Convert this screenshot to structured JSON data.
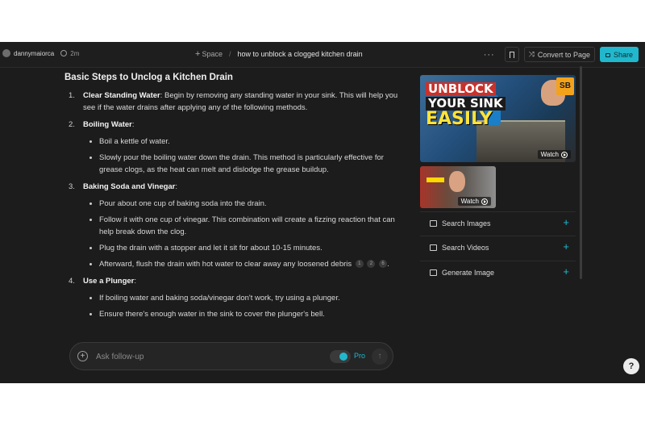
{
  "topbar": {
    "username": "dannymaiorca",
    "time_ago": "2m",
    "space_label": "Space",
    "thread_title": "how to unblock a clogged kitchen drain",
    "more_icon": "more-horizontal-icon",
    "bookmark_icon": "bookmark-icon",
    "convert_label": "Convert to Page",
    "share_label": "Share",
    "accent_color": "#21b8cd"
  },
  "answer": {
    "heading": "Basic Steps to Unclog a Kitchen Drain",
    "steps": [
      {
        "num": "1.",
        "title": "Clear Standing Water",
        "text": ": Begin by removing any standing water in your sink. This will help you see if the water drains after applying any of the following methods.",
        "bullets": []
      },
      {
        "num": "2.",
        "title": "Boiling Water",
        "text": ":",
        "bullets": [
          "Boil a kettle of water.",
          "Slowly pour the boiling water down the drain. This method is particularly effective for grease clogs, as the heat can melt and dislodge the grease buildup."
        ]
      },
      {
        "num": "3.",
        "title": "Baking Soda and Vinegar",
        "text": ":",
        "bullets": [
          "Pour about one cup of baking soda into the drain.",
          "Follow it with one cup of vinegar. This combination will create a fizzing reaction that can help break down the clog.",
          "Plug the drain with a stopper and let it sit for about 10-15 minutes.",
          "Afterward, flush the drain with hot water to clear away any loosened debris"
        ],
        "citations": [
          "1",
          "2",
          "6"
        ]
      },
      {
        "num": "4.",
        "title": "Use a Plunger",
        "text": ":",
        "bullets": [
          "If boiling water and baking soda/vinegar don't work, try using a plunger.",
          "Ensure there's enough water in the sink to cover the plunger's bell."
        ]
      }
    ]
  },
  "followup": {
    "placeholder": "Ask follow-up",
    "pro_label": "Pro",
    "pro_enabled": true
  },
  "sidebar": {
    "video_big": {
      "line1": "UNBLOCK",
      "line2": "YOUR SINK",
      "line3": "EASILY",
      "logo": "SB",
      "watch_label": "Watch"
    },
    "video_small": {
      "watch_label": "Watch"
    },
    "actions": [
      {
        "label": "Search Images",
        "icon": "image-icon"
      },
      {
        "label": "Search Videos",
        "icon": "video-icon"
      },
      {
        "label": "Generate Image",
        "icon": "generate-image-icon"
      }
    ]
  },
  "help_label": "?"
}
